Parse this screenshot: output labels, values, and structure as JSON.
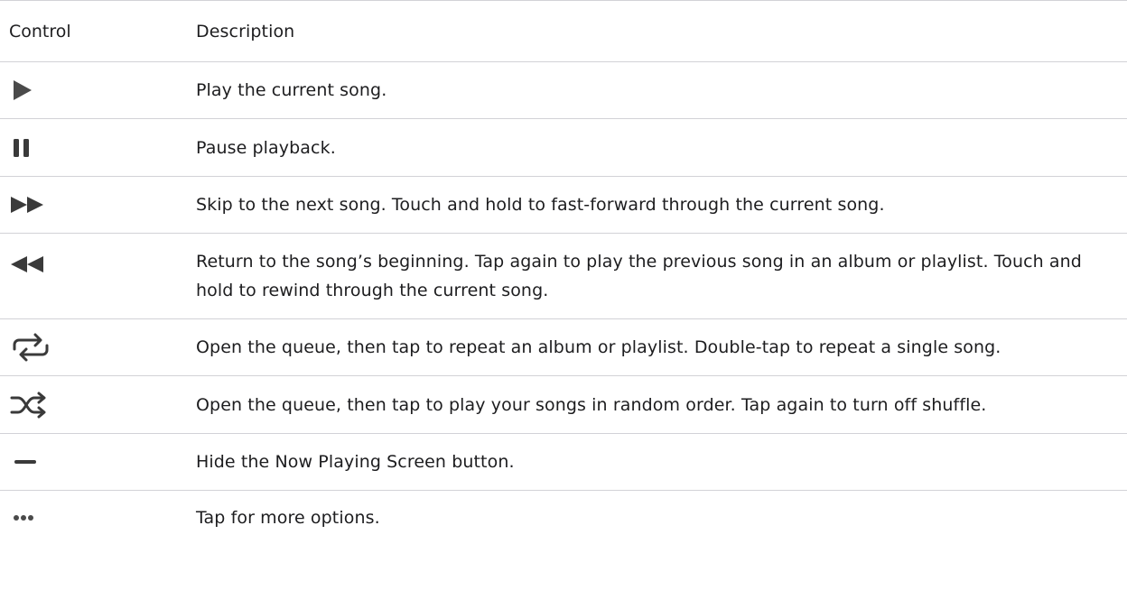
{
  "table": {
    "headers": {
      "control": "Control",
      "description": "Description"
    },
    "rows": [
      {
        "icon": "play-icon",
        "description": "Play the current song."
      },
      {
        "icon": "pause-icon",
        "description": "Pause playback."
      },
      {
        "icon": "fast-forward-icon",
        "description": "Skip to the next song. Touch and hold to fast-forward through the current song."
      },
      {
        "icon": "rewind-icon",
        "description": "Return to the song’s beginning. Tap again to play the previous song in an album or playlist. Touch and hold to rewind through the current song."
      },
      {
        "icon": "repeat-icon",
        "description": "Open the queue, then tap to repeat an album or playlist. Double-tap to repeat a single song."
      },
      {
        "icon": "shuffle-icon",
        "description": "Open the queue, then tap to play your songs in random order. Tap again to turn off shuffle."
      },
      {
        "icon": "minus-icon",
        "description": "Hide the Now Playing Screen button."
      },
      {
        "icon": "more-icon",
        "description": "Tap for more options."
      }
    ]
  },
  "colors": {
    "icon": "#4a4a4a",
    "text": "#1d1d1f",
    "divider": "#d2d2d7"
  }
}
